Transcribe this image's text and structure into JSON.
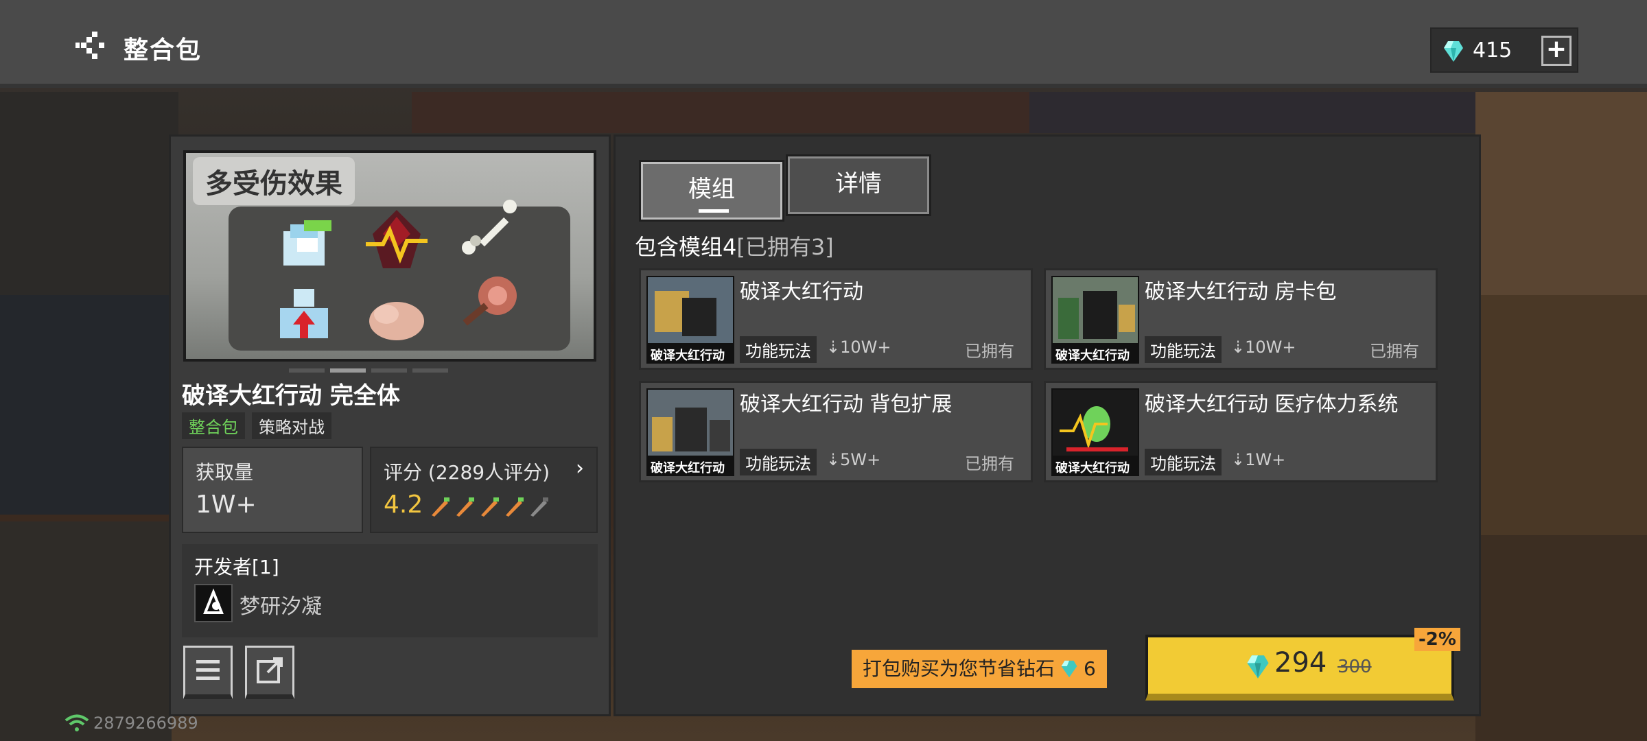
{
  "header": {
    "title": "整合包",
    "currency_amount": "415",
    "add_label": "+"
  },
  "pack": {
    "banner_tag": "多受伤效果",
    "name": "破译大红行动 完全体",
    "tags": [
      "整合包",
      "策略对战"
    ],
    "stats": {
      "downloads_label": "获取量",
      "downloads_value": "1W+",
      "rating_label": "评分 (2289人评分)",
      "rating_value": "4.2",
      "rating_stars": 4.2
    },
    "developer": {
      "label": "开发者[1]",
      "name": "梦研汐凝"
    }
  },
  "tabs": {
    "modules": "模组",
    "details": "详情"
  },
  "contains": {
    "main": "包含模组4",
    "owned": "[已拥有3]"
  },
  "mods": [
    {
      "name": "破译大红行动",
      "category": "功能玩法",
      "downloads": "10W+",
      "status": "已拥有"
    },
    {
      "name": "破译大红行动 房卡包",
      "category": "功能玩法",
      "downloads": "10W+",
      "status": "已拥有"
    },
    {
      "name": "破译大红行动 背包扩展",
      "category": "功能玩法",
      "downloads": "5W+",
      "status": "已拥有"
    },
    {
      "name": "破译大红行动 医疗体力系统",
      "category": "功能玩法",
      "downloads": "1W+",
      "status": ""
    }
  ],
  "thumb_text": "破译大红行动",
  "purchase": {
    "tip": "打包购买为您节省钻石",
    "tip_save": "6",
    "price": "294",
    "old_price": "300",
    "discount": "-2%"
  },
  "status": {
    "id": "2879266989"
  },
  "colors": {
    "accent_yellow": "#f2cb34",
    "accent_orange": "#f7a63a",
    "green": "#6fd25a"
  }
}
